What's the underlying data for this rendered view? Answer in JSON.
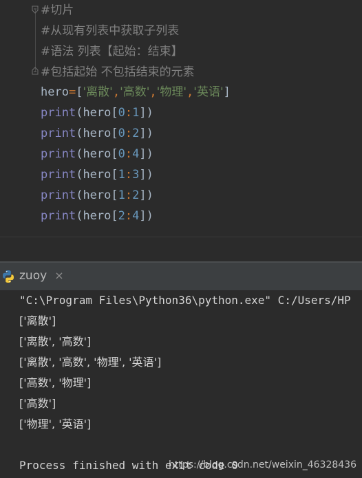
{
  "editor": {
    "comments": [
      "#切片",
      "#从现有列表中获取子列表",
      "#语法 列表【起始：结束】",
      "#包括起始 不包括结束的元素"
    ],
    "assignment": {
      "var": "hero",
      "op": "=",
      "open": "[",
      "items": [
        "'离散'",
        "'高数'",
        "'物理'",
        "'英语'"
      ],
      "sep": ",",
      "close": "]"
    },
    "prints": [
      {
        "fn": "print",
        "arg": "hero",
        "start": "0",
        "end": "1"
      },
      {
        "fn": "print",
        "arg": "hero",
        "start": "0",
        "end": "2"
      },
      {
        "fn": "print",
        "arg": "hero",
        "start": "0",
        "end": "4"
      },
      {
        "fn": "print",
        "arg": "hero",
        "start": "1",
        "end": "3"
      },
      {
        "fn": "print",
        "arg": "hero",
        "start": "1",
        "end": "2"
      },
      {
        "fn": "print",
        "arg": "hero",
        "start": "2",
        "end": "4"
      }
    ]
  },
  "run_panel": {
    "tab_label": "zuoy",
    "close_glyph": "×",
    "icon": "python-icon"
  },
  "console": {
    "command": "\"C:\\Program Files\\Python36\\python.exe\" C:/Users/HP",
    "outputs": [
      "['离散']",
      "['离散', '高数']",
      "['离散', '高数', '物理', '英语']",
      "['高数', '物理']",
      "['高数']",
      "['物理', '英语']"
    ],
    "finished": "Process finished with exit code 0"
  },
  "watermark": "https://blog.csdn.net/weixin_46328436",
  "colors": {
    "editor_bg": "#2b2b2b",
    "comment": "#808080",
    "keyword": "#8888c6",
    "string": "#6a8759",
    "number": "#6897bb",
    "operator": "#cc7832",
    "panel_header": "#3c3f41"
  }
}
